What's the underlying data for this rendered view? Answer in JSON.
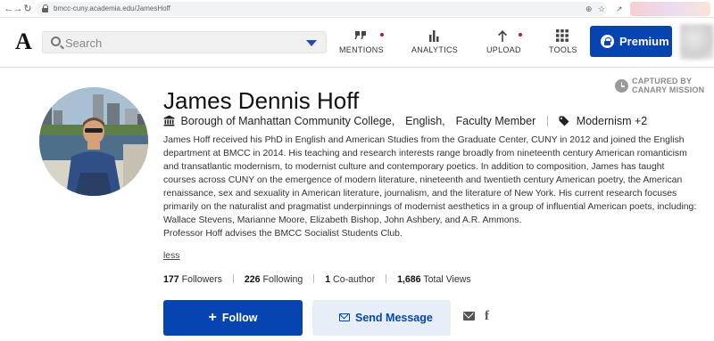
{
  "browser": {
    "url": "bmcc-cuny.academia.edu/JamesHoff",
    "nav_icons": [
      "back-arrow-icon",
      "forward-arrow-icon",
      "reload-icon"
    ]
  },
  "header": {
    "logo": "A",
    "search": {
      "placeholder": "Search"
    },
    "nav": [
      {
        "label": "MENTIONS",
        "icon": "quote-icon",
        "notification": true
      },
      {
        "label": "ANALYTICS",
        "icon": "bar-chart-icon",
        "notification": false
      },
      {
        "label": "UPLOAD",
        "icon": "upload-arrow-icon",
        "notification": true
      },
      {
        "label": "TOOLS",
        "icon": "grid-icon",
        "notification": false
      }
    ],
    "premium_label": "Premium"
  },
  "watermark": {
    "line1": "CAPTURED BY",
    "line2": "CANARY MISSION"
  },
  "profile": {
    "name": "James Dennis Hoff",
    "institution": "Borough of Manhattan Community College,",
    "department": "English,",
    "role": "Faculty Member",
    "research_tag": "Modernism +2",
    "bio_main": "James Hoff received his PhD in English and American Studies from the Graduate Center, CUNY in 2012 and joined the English department at BMCC in 2014. His teaching and research interests range broadly from nineteenth century American romanticism and transatlantic modernism, to modernist culture and contemporary poetics. In addition to composition, James has taught courses across CUNY on the emergence of modern literature, nineteenth and twentieth century American poetry, the American renaissance, sex and sexuality in American literature, journalism, and the literature of New York. His current research focuses primarily on the naturalist and pragmatist underpinnings of modernist aesthetics in a group of influential American poets, including: Wallace Stevens, Marianne Moore, Elizabeth Bishop, John Ashbery, and A.R. Ammons.",
    "bio_extra": "Professor Hoff advises the BMCC Socialist Students Club.",
    "less_label": "less",
    "stats": {
      "followers_num": "177",
      "followers_label": "Followers",
      "following_num": "226",
      "following_label": "Following",
      "coauthor_num": "1",
      "coauthor_label": "Co-author",
      "views_num": "1,686",
      "views_label": "Total Views"
    },
    "follow_label": "Follow",
    "message_label": "Send Message"
  },
  "colors": {
    "brand": "#0645b1",
    "notification": "#c8102e",
    "message_bg": "#e8eef8"
  }
}
